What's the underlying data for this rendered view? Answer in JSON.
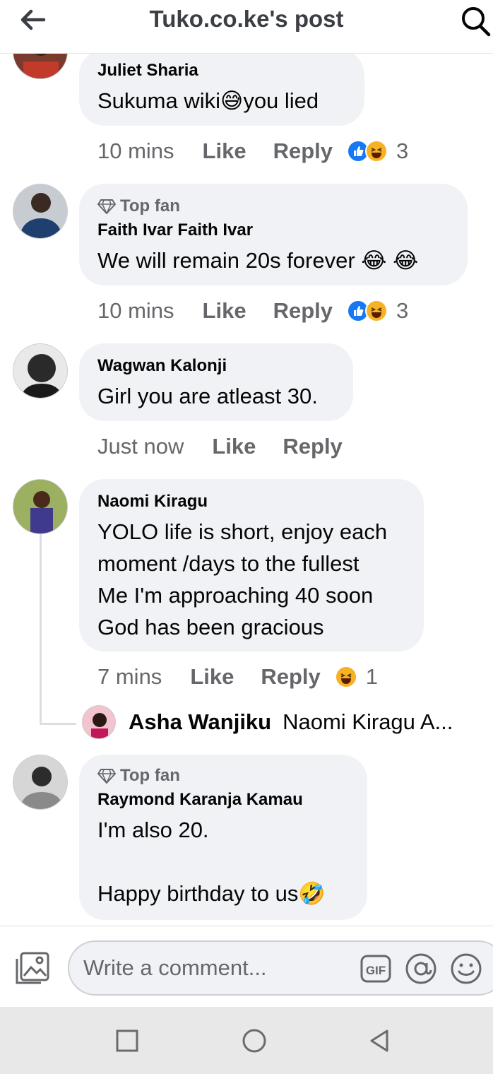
{
  "header": {
    "title": "Tuko.co.ke's post"
  },
  "colors": {
    "like_blue": "#1877f2",
    "haha_yellow": "#f7b125",
    "secondary_text": "#65676b",
    "bubble_bg": "#f0f2f5"
  },
  "comments": [
    {
      "author": "Juliet Sharia",
      "text": "Sukuma wiki😅you lied",
      "time": "10 mins",
      "like_label": "Like",
      "reply_label": "Reply",
      "reaction_count": "3"
    },
    {
      "badge": "Top fan",
      "author": "Faith Ivar Faith Ivar",
      "text": "We will remain 20s forever 😂 😂",
      "time": "10 mins",
      "like_label": "Like",
      "reply_label": "Reply",
      "reaction_count": "3"
    },
    {
      "author": "Wagwan Kalonji",
      "text": "Girl you are atleast 30.",
      "time": "Just now",
      "like_label": "Like",
      "reply_label": "Reply"
    },
    {
      "author": "Naomi Kiragu",
      "text": "YOLO life is short, enjoy each\nmoment /days to the fullest\nMe I'm approaching 40 soon\nGod has been gracious",
      "time": "7 mins",
      "like_label": "Like",
      "reply_label": "Reply",
      "reaction_count": "1",
      "reply_preview": {
        "author": "Asha Wanjiku",
        "snippet": "Naomi Kiragu A..."
      }
    },
    {
      "badge": "Top fan",
      "author": "Raymond Karanja Kamau",
      "text": "I'm also 20.\n\nHappy birthday to us🤣"
    }
  ],
  "composer": {
    "placeholder": "Write a comment..."
  },
  "icons": [
    "back-arrow-icon",
    "search-icon",
    "diamond-icon",
    "like-reaction-icon",
    "haha-reaction-icon",
    "photo-icon",
    "gif-icon",
    "mention-icon",
    "emoji-icon",
    "nav-recents-icon",
    "nav-home-icon",
    "nav-back-icon"
  ]
}
